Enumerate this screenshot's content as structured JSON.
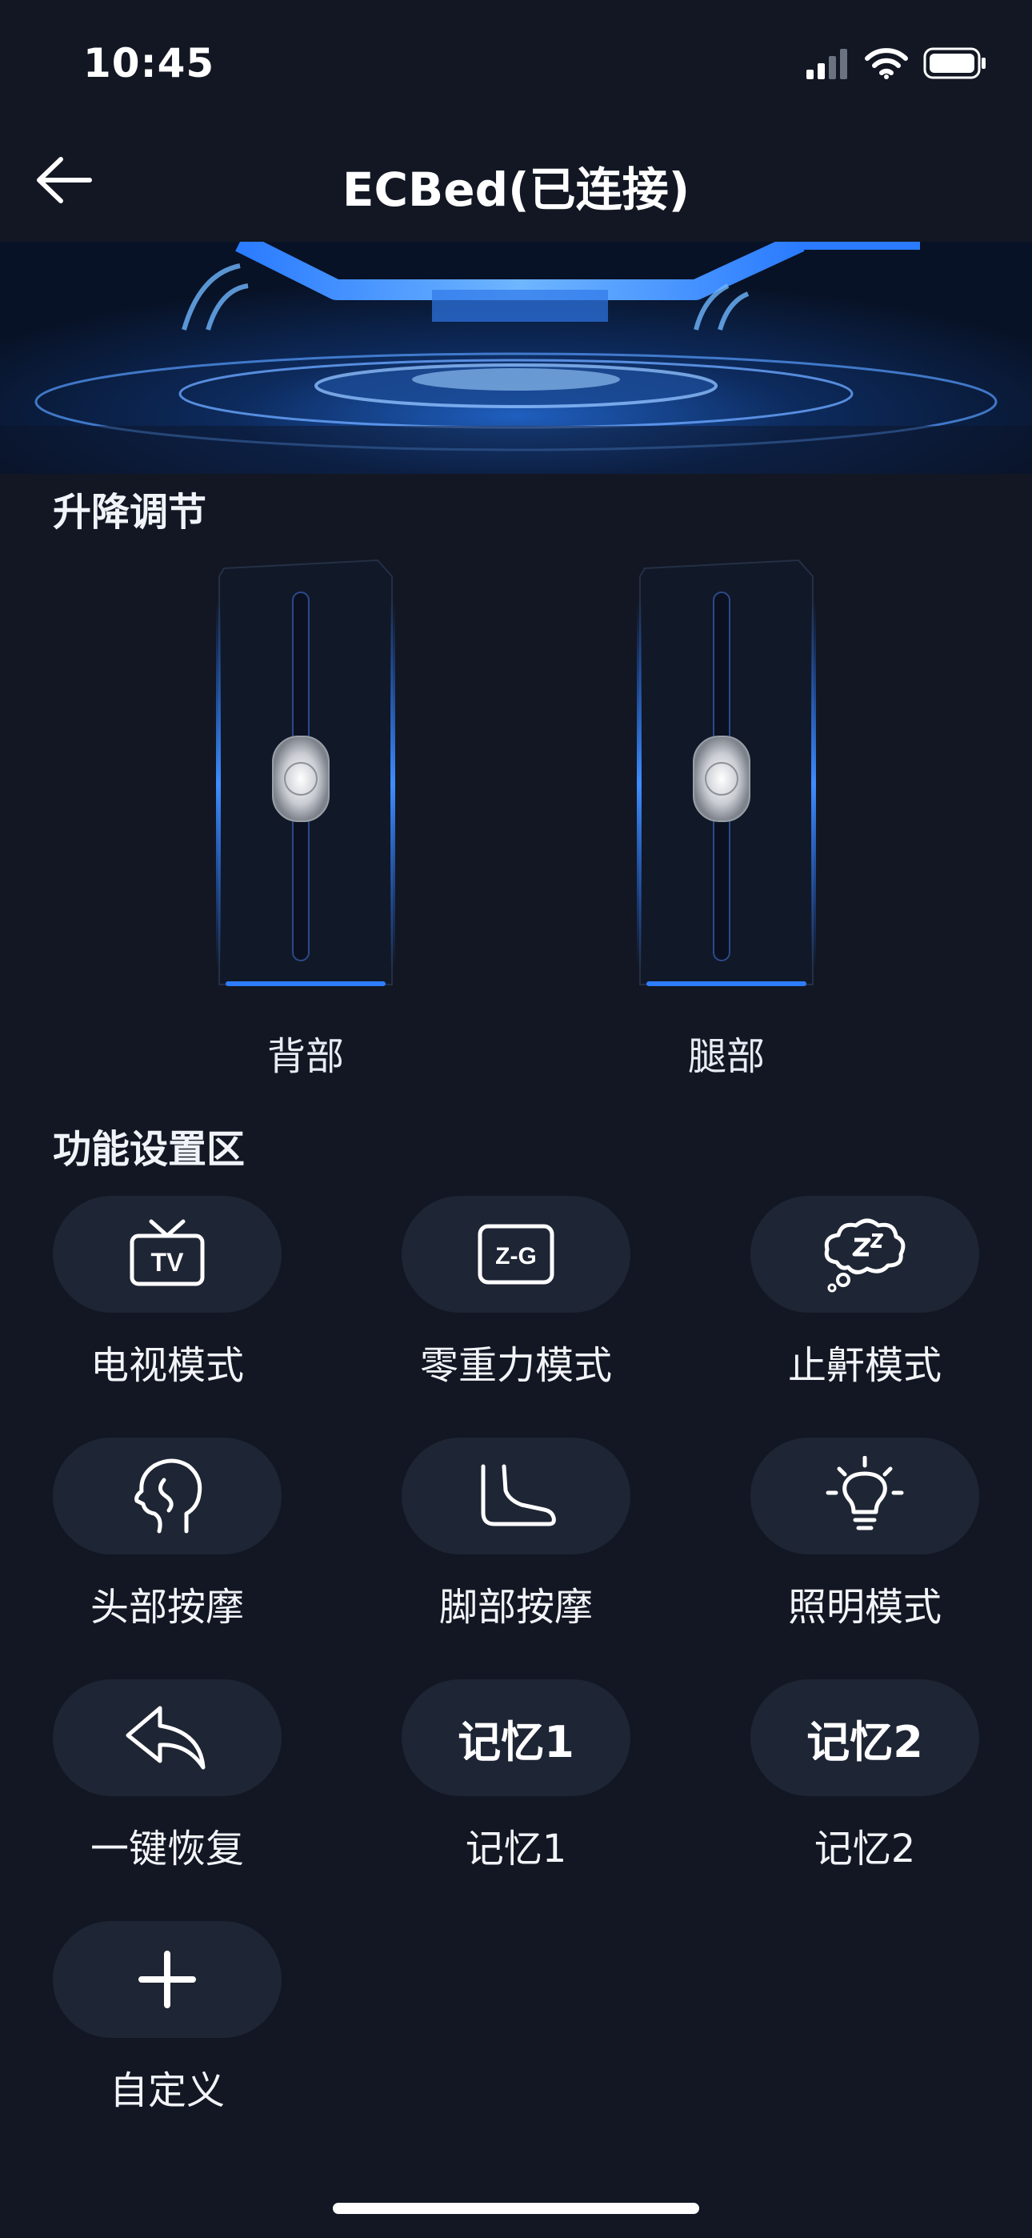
{
  "status_bar": {
    "time": "10:45"
  },
  "header": {
    "title": "ECBed(已连接)"
  },
  "lift": {
    "section_title": "升降调节",
    "sliders": [
      {
        "label": "背部",
        "level": 0.5
      },
      {
        "label": "腿部",
        "level": 0.5
      }
    ]
  },
  "functions": {
    "section_title": "功能设置区",
    "items": [
      {
        "label": "电视模式",
        "icon": "tv-icon"
      },
      {
        "label": "零重力模式",
        "icon": "zero-gravity-icon",
        "icon_text": "Z-G"
      },
      {
        "label": "止鼾模式",
        "icon": "anti-snore-icon"
      },
      {
        "label": "头部按摩",
        "icon": "head-massage-icon"
      },
      {
        "label": "脚部按摩",
        "icon": "foot-massage-icon"
      },
      {
        "label": "照明模式",
        "icon": "lightbulb-icon"
      },
      {
        "label": "一键恢复",
        "icon": "reset-icon"
      },
      {
        "label": "记忆1",
        "icon": "memory-1-icon",
        "pill_text": "记忆1"
      },
      {
        "label": "记忆2",
        "icon": "memory-2-icon",
        "pill_text": "记忆2"
      },
      {
        "label": "自定义",
        "icon": "plus-icon"
      }
    ]
  }
}
